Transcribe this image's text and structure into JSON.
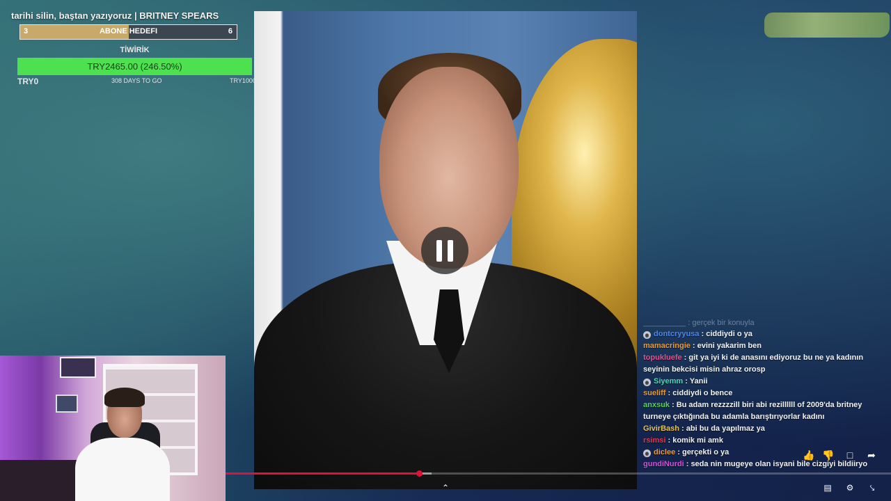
{
  "stream": {
    "title": "tarihi silin, baştan yazıyoruz | BRITNEY SPEARS"
  },
  "sub_goal": {
    "current": "3",
    "target": "6",
    "label": "ABONE HEDEFI",
    "progress_fraction": 0.5
  },
  "tip_goal": {
    "label": "TİWİRİK",
    "amount_text": "TRY2465.00 (246.50%)",
    "min": "TRY0",
    "days_left": "308 DAYS TO GO",
    "max": "TRY1000",
    "progress_fraction": 1.0
  },
  "player": {
    "state": "paused",
    "played_fraction": 0.29,
    "buffered_fraction": 0.31
  },
  "chat": {
    "truncated_top": "__________ : gerçek bir konuyla",
    "messages": [
      {
        "user": "dontcryyusa",
        "text": "ciddiydi o ya",
        "color": "#4f86e8",
        "badge": true
      },
      {
        "user": "mamacringie",
        "text": "evini yakarim ben",
        "color": "#e89a3a",
        "badge": false
      },
      {
        "user": "topukluefe",
        "text": "git ya iyi ki de anasını ediyoruz bu ne ya kadının seyinin bekcisi misin ahraz orosp",
        "color": "#e84f8a",
        "badge": false
      },
      {
        "user": "Siyemm",
        "text": "Yanii",
        "color": "#4fd6b2",
        "badge": true
      },
      {
        "user": "sueliff",
        "text": "ciddiydi o bence",
        "color": "#e89a3a",
        "badge": false
      },
      {
        "user": "anxsuk",
        "text": "Bu adam rezzzzill biri abi rezillllll of 2009'da britney turneye çıktığında bu adamla barıştırıyorlar kadını",
        "color": "#5ad15a",
        "badge": false
      },
      {
        "user": "GivirBash",
        "text": "abi bu da yapılmaz ya",
        "color": "#e8c24f",
        "badge": false
      },
      {
        "user": "rsimsi",
        "text": "komik mi amk",
        "color": "#e8354a",
        "badge": false
      },
      {
        "user": "diclee",
        "text": "gerçekti o ya",
        "color": "#e89a3a",
        "badge": true
      },
      {
        "user": "gundiNurdi",
        "text": "seda nin mugeye olan isyani bile cizgiyi bildiiryo",
        "color": "#d24fd6",
        "badge": false
      }
    ]
  },
  "icons": {
    "like": "thumbs-up-icon",
    "dislike": "thumbs-down-icon",
    "comments": "comment-icon",
    "share": "share-icon",
    "captions": "captions-icon",
    "settings": "settings-icon",
    "exit_fullscreen": "exit-fullscreen-icon",
    "chevron": "chevron-up-icon"
  }
}
